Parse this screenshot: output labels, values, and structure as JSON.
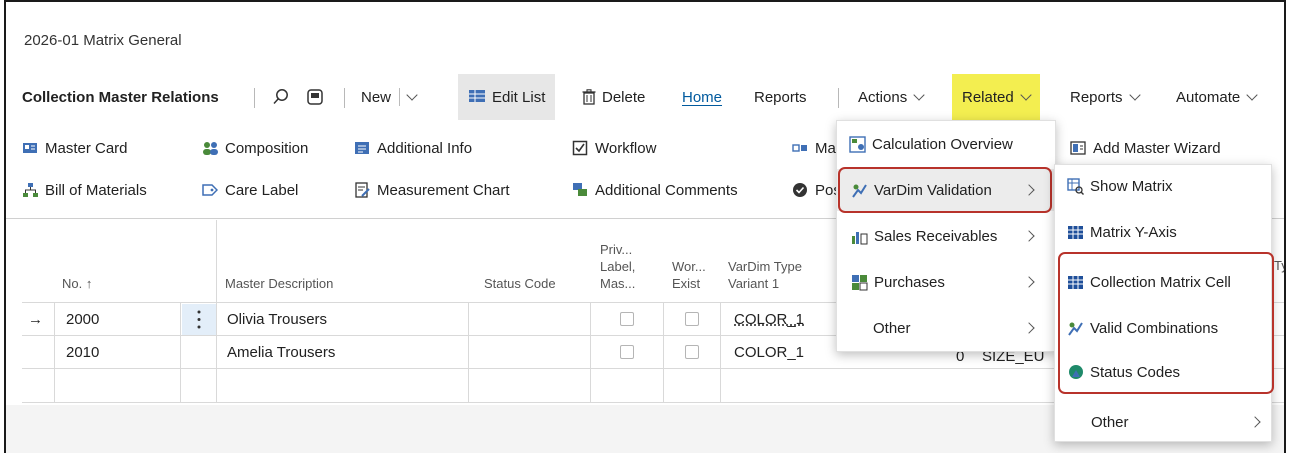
{
  "page": {
    "title": "2026-01 Matrix General"
  },
  "actionbar": {
    "title": "Collection Master Relations",
    "new_label": "New",
    "edit_list_label": "Edit List",
    "delete_label": "Delete",
    "home_label": "Home",
    "reports_label": "Reports",
    "actions_label": "Actions",
    "related_label": "Related",
    "reports2_label": "Reports",
    "automate_label": "Automate"
  },
  "promoted": {
    "row1": [
      "Master Card",
      "Composition",
      "Additional Info",
      "Workflow",
      "Ma"
    ],
    "row2": [
      "Bill of Materials",
      "Care Label",
      "Measurement Chart",
      "Additional Comments",
      "Pos"
    ]
  },
  "grid": {
    "headers": {
      "no": "No.",
      "no_sort": "↑",
      "desc": "Master Description",
      "status": "Status Code",
      "priv": [
        "Priv...",
        "Label,",
        "Mas..."
      ],
      "wor": [
        "Wor...",
        "Exist"
      ],
      "vardim": [
        "VarDim Type",
        "Variant 1"
      ],
      "typ": "Typ"
    },
    "rows": [
      {
        "marker": "→",
        "no": "2000",
        "desc": "Olivia Trousers",
        "status": "",
        "vardim1": "COLOR_1",
        "num": "",
        "vardim2": ""
      },
      {
        "marker": "",
        "no": "2010",
        "desc": "Amelia Trousers",
        "status": "",
        "vardim1": "COLOR_1",
        "num": "0",
        "vardim2": "SIZE_EU"
      }
    ]
  },
  "related_menu": {
    "items": [
      "Calculation Overview",
      "VarDim Validation",
      "Sales Receivables",
      "Purchases",
      "Other"
    ]
  },
  "right_col": {
    "add_master": "Add Master Wizard"
  },
  "submenu": {
    "items": [
      "Show Matrix",
      "Matrix Y-Axis",
      "Collection Matrix Cell",
      "Valid Combinations",
      "Status Codes",
      "Other"
    ]
  },
  "colors": {
    "accent": "#005a9e",
    "highlight": "#f3ee50",
    "callout": "#b8332b"
  }
}
